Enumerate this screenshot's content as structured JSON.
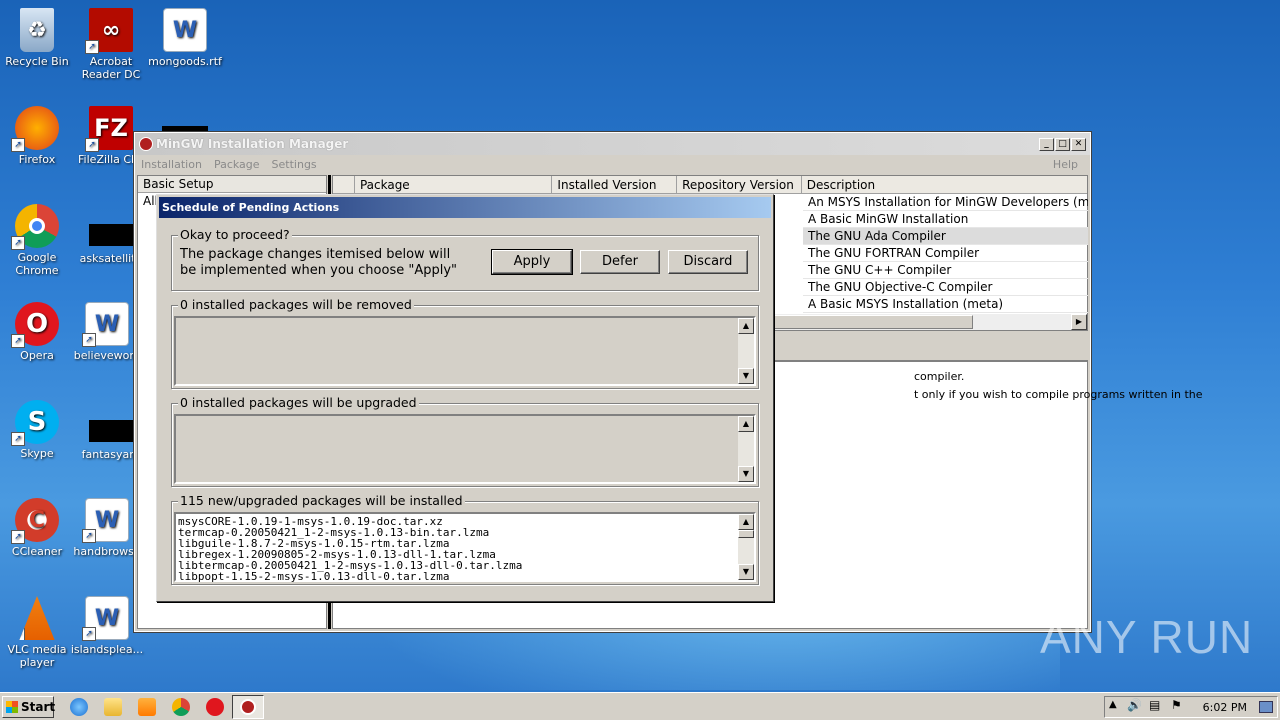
{
  "desktop": {
    "icons": [
      {
        "label": "Recycle Bin"
      },
      {
        "label": "Acrobat Reader DC"
      },
      {
        "label": "mongoods.rtf"
      },
      {
        "label": "Firefox"
      },
      {
        "label": "FileZilla Clie"
      },
      {
        "label": "Google Chrome"
      },
      {
        "label": "asksatellite"
      },
      {
        "label": "Opera"
      },
      {
        "label": "believework"
      },
      {
        "label": "Skype"
      },
      {
        "label": "fantasyare"
      },
      {
        "label": "CCleaner"
      },
      {
        "label": "handbrowse"
      },
      {
        "label": "VLC media player"
      },
      {
        "label": "islandsplea..."
      }
    ]
  },
  "manager": {
    "title": "MinGW Installation Manager",
    "menu": [
      "Installation",
      "Package",
      "Settings"
    ],
    "help": "Help",
    "left_header": "Basic Setup",
    "left_row": "All",
    "columns": [
      "Package",
      "Installed Version",
      "Repository Version",
      "Description"
    ],
    "descriptions": [
      "An MSYS Installation for MinGW Developers (met",
      "A Basic MinGW Installation",
      "The GNU Ada Compiler",
      "The GNU FORTRAN Compiler",
      "The GNU C++ Compiler",
      "The GNU Objective-C Compiler",
      "A Basic MSYS Installation (meta)"
    ],
    "detail_line1": "compiler.",
    "detail_line2": "t only if you wish to compile programs written in the"
  },
  "dialog": {
    "title": "Schedule of Pending Actions",
    "proceed_legend": "Okay to proceed?",
    "proceed_text1": "The package changes itemised below will",
    "proceed_text2": "be implemented when you choose \"Apply\"",
    "apply": "Apply",
    "defer": "Defer",
    "discard": "Discard",
    "removed_legend": "0 installed packages will be removed",
    "upgraded_legend": "0 installed packages will be upgraded",
    "install_legend": "115 new/upgraded packages will be installed",
    "install_list": [
      "msysCORE-1.0.19-1-msys-1.0.19-doc.tar.xz",
      "termcap-0.20050421_1-2-msys-1.0.13-bin.tar.lzma",
      "libguile-1.8.7-2-msys-1.0.15-rtm.tar.lzma",
      "libregex-1.20090805-2-msys-1.0.13-dll-1.tar.lzma",
      "libtermcap-0.20050421_1-2-msys-1.0.13-dll-0.tar.lzma",
      "libpopt-1.15-2-msys-1.0.13-dll-0.tar.lzma"
    ]
  },
  "taskbar": {
    "start": "Start",
    "clock": "6:02 PM"
  },
  "watermark": "ANY RUN",
  "colors": {
    "dialog_title_start": "#0a246a",
    "dialog_title_end": "#a6caf0",
    "face": "#d4d0c8"
  }
}
